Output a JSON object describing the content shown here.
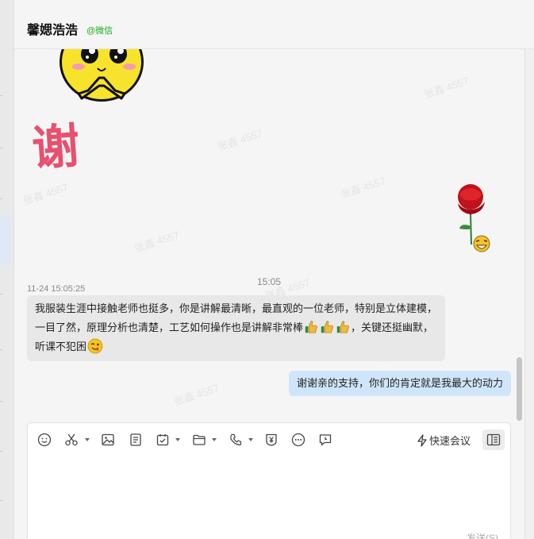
{
  "header": {
    "name": "馨媤浩浩",
    "tag": "@微信"
  },
  "watermark": "张鑫 4557",
  "stickers": {
    "char": "谢"
  },
  "time_divider": "15:05",
  "message_left": {
    "timestamp": "11-24 15:05:25",
    "text_1": "我服装生涯中接触老师也挺多，你是讲解最清晰，最直观的一位老师，特别是立体建模，一目了然，原理分析也清楚，工艺如何操作也是讲解非常棒",
    "text_2": "，关键还挺幽默，听课不犯困"
  },
  "message_right": {
    "text": "谢谢亲的支持，你们的肯定就是我最大的动力"
  },
  "composer": {
    "quick_meeting": "快速会议",
    "send": "发送(S)"
  },
  "icons": [
    "emoji-icon",
    "scissors-icon",
    "image-icon",
    "document-icon",
    "task-icon",
    "folder-icon",
    "phone-icon",
    "money-icon",
    "more-icon",
    "chat-bubble-icon",
    "lightning-icon",
    "side-panel-icon"
  ]
}
